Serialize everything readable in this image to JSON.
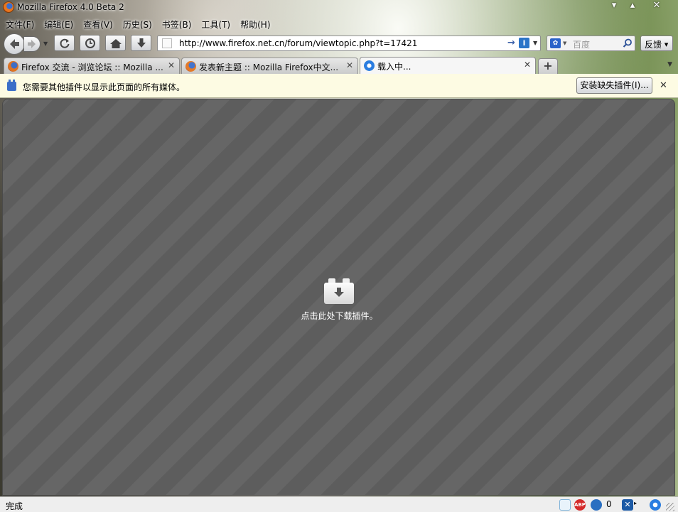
{
  "window": {
    "title": "Mozilla Firefox 4.0 Beta 2"
  },
  "menu": [
    {
      "label": "文件(F)"
    },
    {
      "label": "编辑(E)"
    },
    {
      "label": "查看(V)"
    },
    {
      "label": "历史(S)"
    },
    {
      "label": "书签(B)"
    },
    {
      "label": "工具(T)"
    },
    {
      "label": "帮助(H)"
    }
  ],
  "nav": {
    "url": "http://www.firefox.net.cn/forum/viewtopic.php?t=17421",
    "search_placeholder": "百度",
    "feedback_label": "反馈"
  },
  "tabs": [
    {
      "title": "Firefox 交流 - 浏览论坛 :: Mozilla ...",
      "icon": "firefox-icon"
    },
    {
      "title": "发表新主题 :: Mozilla Firefox中文...",
      "icon": "firefox-icon"
    },
    {
      "title": "载入中...",
      "icon": "ie-icon",
      "active": true
    }
  ],
  "notification": {
    "message": "您需要其他插件以显示此页面的所有媒体。",
    "install_label": "安装缺失插件(I)..."
  },
  "content": {
    "download_prompt": "点击此处下载插件。"
  },
  "status": {
    "text": "完成",
    "count": "0"
  },
  "colors": {
    "content_bg": "#666666",
    "notification_bg": "#fdfbe3",
    "accent": "#3b6ec8"
  }
}
